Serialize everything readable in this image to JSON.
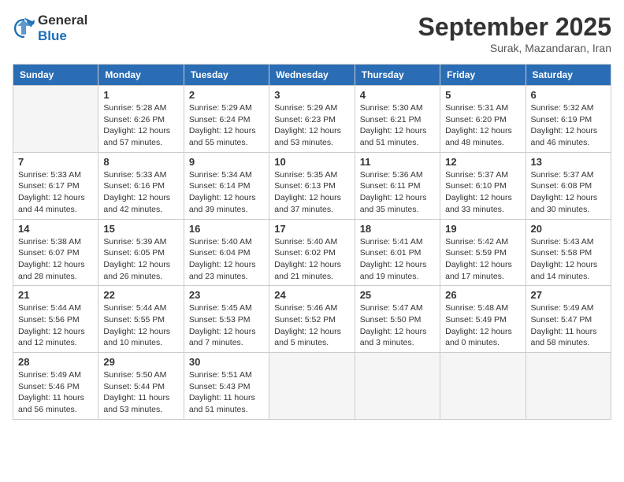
{
  "logo": {
    "general": "General",
    "blue": "Blue"
  },
  "header": {
    "month": "September 2025",
    "location": "Surak, Mazandaran, Iran"
  },
  "weekdays": [
    "Sunday",
    "Monday",
    "Tuesday",
    "Wednesday",
    "Thursday",
    "Friday",
    "Saturday"
  ],
  "weeks": [
    [
      {
        "day": "",
        "info": ""
      },
      {
        "day": "1",
        "info": "Sunrise: 5:28 AM\nSunset: 6:26 PM\nDaylight: 12 hours\nand 57 minutes."
      },
      {
        "day": "2",
        "info": "Sunrise: 5:29 AM\nSunset: 6:24 PM\nDaylight: 12 hours\nand 55 minutes."
      },
      {
        "day": "3",
        "info": "Sunrise: 5:29 AM\nSunset: 6:23 PM\nDaylight: 12 hours\nand 53 minutes."
      },
      {
        "day": "4",
        "info": "Sunrise: 5:30 AM\nSunset: 6:21 PM\nDaylight: 12 hours\nand 51 minutes."
      },
      {
        "day": "5",
        "info": "Sunrise: 5:31 AM\nSunset: 6:20 PM\nDaylight: 12 hours\nand 48 minutes."
      },
      {
        "day": "6",
        "info": "Sunrise: 5:32 AM\nSunset: 6:19 PM\nDaylight: 12 hours\nand 46 minutes."
      }
    ],
    [
      {
        "day": "7",
        "info": "Sunrise: 5:33 AM\nSunset: 6:17 PM\nDaylight: 12 hours\nand 44 minutes."
      },
      {
        "day": "8",
        "info": "Sunrise: 5:33 AM\nSunset: 6:16 PM\nDaylight: 12 hours\nand 42 minutes."
      },
      {
        "day": "9",
        "info": "Sunrise: 5:34 AM\nSunset: 6:14 PM\nDaylight: 12 hours\nand 39 minutes."
      },
      {
        "day": "10",
        "info": "Sunrise: 5:35 AM\nSunset: 6:13 PM\nDaylight: 12 hours\nand 37 minutes."
      },
      {
        "day": "11",
        "info": "Sunrise: 5:36 AM\nSunset: 6:11 PM\nDaylight: 12 hours\nand 35 minutes."
      },
      {
        "day": "12",
        "info": "Sunrise: 5:37 AM\nSunset: 6:10 PM\nDaylight: 12 hours\nand 33 minutes."
      },
      {
        "day": "13",
        "info": "Sunrise: 5:37 AM\nSunset: 6:08 PM\nDaylight: 12 hours\nand 30 minutes."
      }
    ],
    [
      {
        "day": "14",
        "info": "Sunrise: 5:38 AM\nSunset: 6:07 PM\nDaylight: 12 hours\nand 28 minutes."
      },
      {
        "day": "15",
        "info": "Sunrise: 5:39 AM\nSunset: 6:05 PM\nDaylight: 12 hours\nand 26 minutes."
      },
      {
        "day": "16",
        "info": "Sunrise: 5:40 AM\nSunset: 6:04 PM\nDaylight: 12 hours\nand 23 minutes."
      },
      {
        "day": "17",
        "info": "Sunrise: 5:40 AM\nSunset: 6:02 PM\nDaylight: 12 hours\nand 21 minutes."
      },
      {
        "day": "18",
        "info": "Sunrise: 5:41 AM\nSunset: 6:01 PM\nDaylight: 12 hours\nand 19 minutes."
      },
      {
        "day": "19",
        "info": "Sunrise: 5:42 AM\nSunset: 5:59 PM\nDaylight: 12 hours\nand 17 minutes."
      },
      {
        "day": "20",
        "info": "Sunrise: 5:43 AM\nSunset: 5:58 PM\nDaylight: 12 hours\nand 14 minutes."
      }
    ],
    [
      {
        "day": "21",
        "info": "Sunrise: 5:44 AM\nSunset: 5:56 PM\nDaylight: 12 hours\nand 12 minutes."
      },
      {
        "day": "22",
        "info": "Sunrise: 5:44 AM\nSunset: 5:55 PM\nDaylight: 12 hours\nand 10 minutes."
      },
      {
        "day": "23",
        "info": "Sunrise: 5:45 AM\nSunset: 5:53 PM\nDaylight: 12 hours\nand 7 minutes."
      },
      {
        "day": "24",
        "info": "Sunrise: 5:46 AM\nSunset: 5:52 PM\nDaylight: 12 hours\nand 5 minutes."
      },
      {
        "day": "25",
        "info": "Sunrise: 5:47 AM\nSunset: 5:50 PM\nDaylight: 12 hours\nand 3 minutes."
      },
      {
        "day": "26",
        "info": "Sunrise: 5:48 AM\nSunset: 5:49 PM\nDaylight: 12 hours\nand 0 minutes."
      },
      {
        "day": "27",
        "info": "Sunrise: 5:49 AM\nSunset: 5:47 PM\nDaylight: 11 hours\nand 58 minutes."
      }
    ],
    [
      {
        "day": "28",
        "info": "Sunrise: 5:49 AM\nSunset: 5:46 PM\nDaylight: 11 hours\nand 56 minutes."
      },
      {
        "day": "29",
        "info": "Sunrise: 5:50 AM\nSunset: 5:44 PM\nDaylight: 11 hours\nand 53 minutes."
      },
      {
        "day": "30",
        "info": "Sunrise: 5:51 AM\nSunset: 5:43 PM\nDaylight: 11 hours\nand 51 minutes."
      },
      {
        "day": "",
        "info": ""
      },
      {
        "day": "",
        "info": ""
      },
      {
        "day": "",
        "info": ""
      },
      {
        "day": "",
        "info": ""
      }
    ]
  ]
}
